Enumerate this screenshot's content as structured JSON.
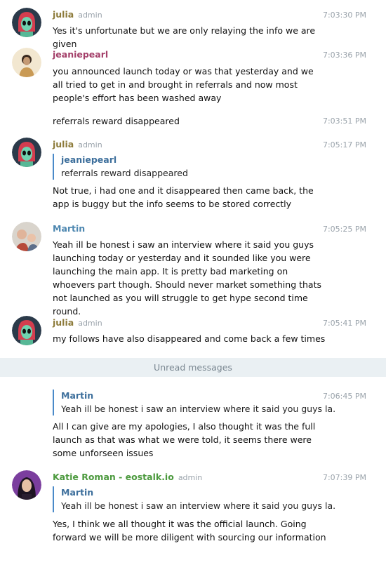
{
  "messages": [
    {
      "name": "julia",
      "role": "admin",
      "time": "7:03:30 PM",
      "text": "Yes it's unfortunate but we are only relaying the info we are given"
    },
    {
      "name": "jeaniepearl",
      "time": "7:03:36 PM",
      "text": "you announced launch today or was that yesterday  and we all tried to get in and brought in referrals and now most people's effort has been washed away"
    },
    {
      "time": "7:03:51 PM",
      "text": "referrals reward disappeared"
    },
    {
      "name": "julia",
      "role": "admin",
      "time": "7:05:17 PM",
      "reply": {
        "name": "jeaniepearl",
        "text": "referrals reward disappeared"
      },
      "text": "Not true, i had one and it disappeared then came back, the app is buggy but the info seems to be stored correctly"
    },
    {
      "name": "Martin",
      "time": "7:05:25 PM",
      "text": "Yeah ill be honest i saw an interview where it said you guys launching today or yesterday and it sounded like you were launching the main app. It is pretty bad marketing on whoevers part though. Should never market something thats not launched as you will struggle to get hype second time round."
    },
    {
      "name": "julia",
      "role": "admin",
      "time": "7:05:41 PM",
      "text": "my follows have also disappeared and come back a few times"
    },
    {
      "time": "7:06:45 PM",
      "reply": {
        "name": "Martin",
        "text": "Yeah ill be honest i saw an interview where it said you guys la..."
      },
      "text": "All I can give are my apologies, I also thought it was the full launch as that was what we were told, it seems there were some unforseen issues"
    },
    {
      "name": "Katie Roman - eostalk.io",
      "role": "admin",
      "time": "7:07:39 PM",
      "reply": {
        "name": "Martin",
        "text": "Yeah ill be honest i saw an interview where it said you guys la..."
      },
      "text": "Yes, I think we all thought it was the official launch. Going forward we will be more diligent with sourcing our information"
    }
  ],
  "divider_label": "Unread messages",
  "colors": {
    "julia": "#8d7b3a",
    "jeaniepearl": "#a4406a",
    "martin": "#4d87b0",
    "katie": "#4d9a3f",
    "reply_bar": "#4a8ac9",
    "divider_bg": "#eaf0f3"
  }
}
